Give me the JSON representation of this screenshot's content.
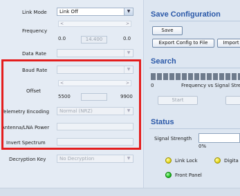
{
  "left": {
    "link_mode": {
      "label": "Link Mode",
      "value": "Link Off"
    },
    "frequency": {
      "label": "Frequency",
      "min": "0.0",
      "value": "14.400",
      "max": "0.0"
    },
    "data_rate": {
      "label": "Data Rate",
      "value": ""
    },
    "baud_rate": {
      "label": "Baud Rate",
      "value": ""
    },
    "offset": {
      "label": "Offset",
      "min": "5500",
      "max": "9900",
      "value": ""
    },
    "telemetry_encoding": {
      "label": "Telemetry Encoding",
      "value": "Normal (NRZ)"
    },
    "antenna_lna_power": {
      "label": "Antenna/LNA Power",
      "value": ""
    },
    "invert_spectrum": {
      "label": "Invert Spectrum",
      "value": ""
    },
    "decryption_key": {
      "label": "Decryption Key",
      "value": "No Decryption"
    }
  },
  "right": {
    "save_config": {
      "title": "Save Configuration",
      "save_label": "Save",
      "export_label": "Export Config to File",
      "import_label": "Import"
    },
    "search": {
      "title": "Search",
      "axis_zero": "0",
      "graph_label": "Frequency vs Signal Stre",
      "start_label": "Start"
    },
    "status": {
      "title": "Status",
      "signal_label": "Signal Strength",
      "signal_value": "0%",
      "link_lock": "Link Lock",
      "digital": "Digita",
      "front_panel": "Front Panel"
    }
  },
  "colors": {
    "section_title": "#2a58a8",
    "highlight_border": "#e41d1d",
    "led_yellow": "#e6d81a",
    "led_green": "#21c321"
  }
}
